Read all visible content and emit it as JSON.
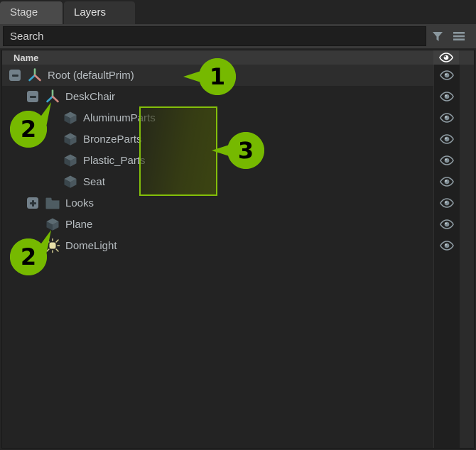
{
  "tabs": [
    {
      "label": "Stage",
      "active": false
    },
    {
      "label": "Layers",
      "active": true
    }
  ],
  "search": {
    "placeholder": "Search",
    "filter_icon": "filter-funnel-icon",
    "menu_icon": "hamburger-menu-icon"
  },
  "tree": {
    "header": {
      "name_column": "Name",
      "visibility_icon": "eye-icon"
    },
    "rows": [
      {
        "label": "Root (defaultPrim)",
        "icon": "xform-axis-icon",
        "depth": 0,
        "expander": "minus",
        "selected": true,
        "visible": true
      },
      {
        "label": "DeskChair",
        "icon": "xform-axis-icon",
        "depth": 1,
        "expander": "minus",
        "selected": false,
        "visible": true
      },
      {
        "label": "AluminumParts",
        "icon": "mesh-cube-icon",
        "depth": 2,
        "expander": "none",
        "selected": false,
        "visible": true
      },
      {
        "label": "BronzeParts",
        "icon": "mesh-cube-icon",
        "depth": 2,
        "expander": "none",
        "selected": false,
        "visible": true
      },
      {
        "label": "Plastic_Parts",
        "icon": "mesh-cube-icon",
        "depth": 2,
        "expander": "none",
        "selected": false,
        "visible": true
      },
      {
        "label": "Seat",
        "icon": "mesh-cube-icon",
        "depth": 2,
        "expander": "none",
        "selected": false,
        "visible": true
      },
      {
        "label": "Looks",
        "icon": "folder-icon",
        "depth": 1,
        "expander": "plus",
        "selected": false,
        "visible": true
      },
      {
        "label": "Plane",
        "icon": "mesh-cube-icon",
        "depth": 1,
        "expander": "none",
        "selected": false,
        "visible": true
      },
      {
        "label": "DomeLight",
        "icon": "dome-light-icon",
        "depth": 1,
        "expander": "none",
        "selected": false,
        "visible": true
      }
    ]
  },
  "annotations": {
    "accent_color": "#76b900",
    "badges": [
      {
        "text": "1",
        "points_to": "Root (defaultPrim)"
      },
      {
        "text": "2",
        "points_to": "DeskChair"
      },
      {
        "text": "3",
        "points_to": "DeskChair children group"
      },
      {
        "text": "2",
        "points_to": "DomeLight"
      }
    ],
    "highlight_box": {
      "label": "deskchair-children-highlight"
    }
  },
  "scrollbar": {
    "orientation": "vertical"
  }
}
